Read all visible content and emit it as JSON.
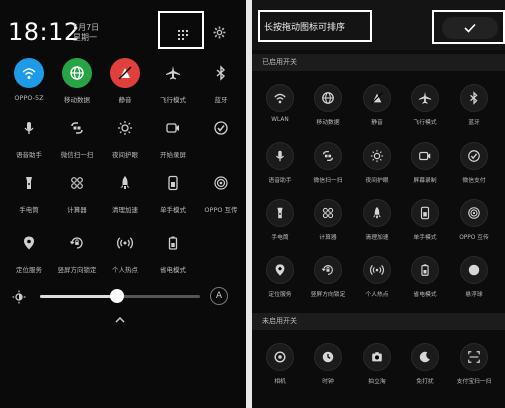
{
  "left": {
    "time": "18:12",
    "date_line1": "5月7日",
    "date_line2": "星期一",
    "tiles": [
      {
        "label": "OPPO-5Z",
        "icon": "wifi-icon",
        "color": "#1e9be6",
        "active": true
      },
      {
        "label": "移动数据",
        "icon": "globe-icon",
        "color": "#27a546",
        "active": true
      },
      {
        "label": "静音",
        "icon": "mute-icon",
        "color": "#e0403c",
        "active": true
      },
      {
        "label": "飞行模式",
        "icon": "airplane-icon",
        "color": "#2a2a2a",
        "active": false
      },
      {
        "label": "蓝牙",
        "icon": "bluetooth-icon",
        "color": "#2a2a2a",
        "active": false
      },
      {
        "label": "语音助手",
        "icon": "mic-icon",
        "color": "#2a2a2a",
        "active": false
      },
      {
        "label": "微信扫一扫",
        "icon": "scan-icon",
        "color": "#2a2a2a",
        "active": false
      },
      {
        "label": "夜间护眼",
        "icon": "eye-protect-icon",
        "color": "#2a2a2a",
        "active": false
      },
      {
        "label": "开始录屏",
        "icon": "screen-record-icon",
        "color": "#2a2a2a",
        "active": false
      },
      {
        "label": "",
        "icon": "wechat-pay-icon",
        "color": "#2a2a2a",
        "active": false
      },
      {
        "label": "手电筒",
        "icon": "flashlight-icon",
        "color": "#2a2a2a",
        "active": false
      },
      {
        "label": "计算器",
        "icon": "calculator-icon",
        "color": "#2a2a2a",
        "active": false
      },
      {
        "label": "清理加速",
        "icon": "rocket-icon",
        "color": "#2a2a2a",
        "active": false
      },
      {
        "label": "单手模式",
        "icon": "one-hand-icon",
        "color": "#2a2a2a",
        "active": false
      },
      {
        "label": "OPPO 互传",
        "icon": "share-icon",
        "color": "#2a2a2a",
        "active": false
      },
      {
        "label": "定位服务",
        "icon": "location-icon",
        "color": "#2a2a2a",
        "active": false
      },
      {
        "label": "竖屏方向锁定",
        "icon": "rotation-lock-icon",
        "color": "#2a2a2a",
        "active": false
      },
      {
        "label": "个人热点",
        "icon": "hotspot-icon",
        "color": "#2a2a2a",
        "active": false
      },
      {
        "label": "省电模式",
        "icon": "battery-saver-icon",
        "color": "#2a2a2a",
        "active": false
      }
    ],
    "brightness_level": 0.48,
    "auto_brightness_label": "A"
  },
  "right": {
    "hint": "长按拖动图标可排序",
    "enabled_header": "已启用开关",
    "disabled_header": "未启用开关",
    "enabled_tiles": [
      {
        "label": "WLAN",
        "icon": "wifi-icon"
      },
      {
        "label": "移动数据",
        "icon": "globe-icon"
      },
      {
        "label": "静音",
        "icon": "mute-icon"
      },
      {
        "label": "飞行模式",
        "icon": "airplane-icon"
      },
      {
        "label": "蓝牙",
        "icon": "bluetooth-icon"
      },
      {
        "label": "语音助手",
        "icon": "mic-icon"
      },
      {
        "label": "微信扫一扫",
        "icon": "scan-icon"
      },
      {
        "label": "夜间护眼",
        "icon": "eye-protect-icon"
      },
      {
        "label": "屏幕录制",
        "icon": "screen-record-icon"
      },
      {
        "label": "微信支付",
        "icon": "wechat-pay-icon"
      },
      {
        "label": "手电筒",
        "icon": "flashlight-icon"
      },
      {
        "label": "计算器",
        "icon": "calculator-icon"
      },
      {
        "label": "清理加速",
        "icon": "rocket-icon"
      },
      {
        "label": "单手模式",
        "icon": "one-hand-icon"
      },
      {
        "label": "OPPO 互传",
        "icon": "share-icon"
      },
      {
        "label": "定位服务",
        "icon": "location-icon"
      },
      {
        "label": "竖屏方向锁定",
        "icon": "rotation-lock-icon"
      },
      {
        "label": "个人热点",
        "icon": "hotspot-icon"
      },
      {
        "label": "省电模式",
        "icon": "battery-saver-icon"
      },
      {
        "label": "悬浮球",
        "icon": "float-ball-icon"
      }
    ],
    "disabled_tiles": [
      {
        "label": "相机",
        "icon": "camera-icon"
      },
      {
        "label": "时钟",
        "icon": "clock-icon"
      },
      {
        "label": "拍立淘",
        "icon": "photo-search-icon"
      },
      {
        "label": "免打扰",
        "icon": "moon-icon"
      },
      {
        "label": "支付宝扫一扫",
        "icon": "alipay-scan-icon"
      }
    ]
  }
}
